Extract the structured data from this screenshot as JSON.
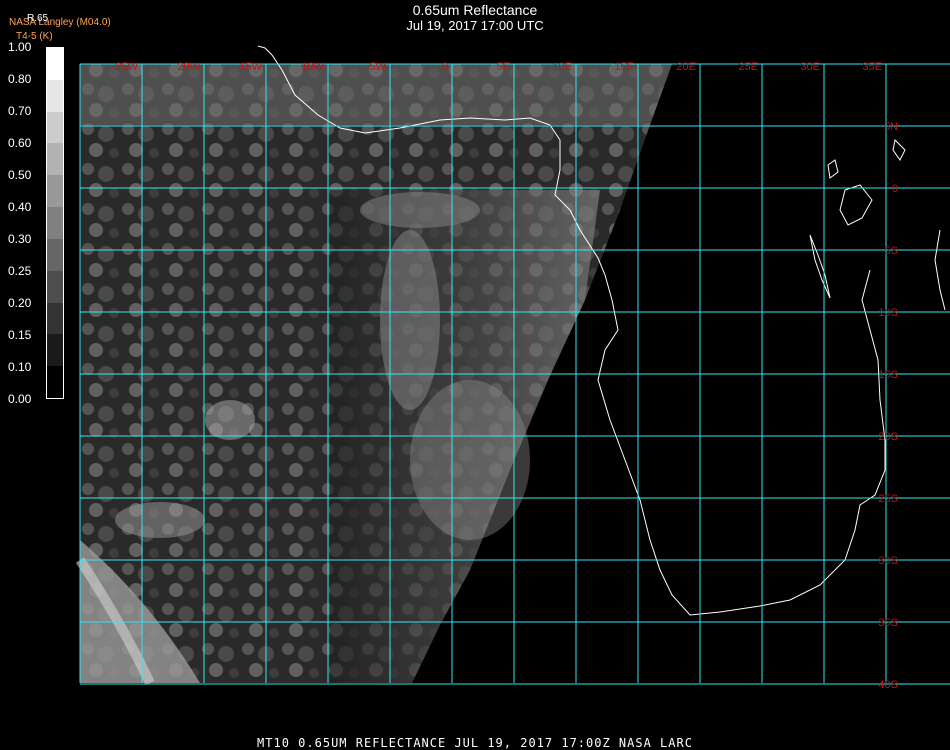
{
  "header": {
    "title": "0.65um Reflectance",
    "subtitle": "Jul 19, 2017 17:00 UTC",
    "credit": "NASA Langley (M04.0)",
    "credit_sub": "T4-5 (K)",
    "scale_unit": "R.65"
  },
  "scale": {
    "labels": [
      "1.00",
      "0.80",
      "0.70",
      "0.60",
      "0.50",
      "0.40",
      "0.30",
      "0.25",
      "0.20",
      "0.15",
      "0.10",
      "0.00"
    ]
  },
  "map": {
    "longitude_labels": [
      "25W",
      "20W",
      "15W",
      "10W",
      "5W",
      "0",
      "5E",
      "10E",
      "15E",
      "20E",
      "25E",
      "30E",
      "35E"
    ],
    "latitude_labels": [
      "5N",
      "0",
      "5S",
      "10S",
      "15S",
      "20S",
      "25S",
      "30S",
      "35S",
      "40S"
    ],
    "grid_color": "#33e6f2",
    "label_color": "#cc1111",
    "coastline_color": "#ffffff"
  },
  "footer": {
    "text": "MT10   0.65UM REFLECTANCE    JUL 19, 2017 17:00Z    NASA LARC"
  }
}
